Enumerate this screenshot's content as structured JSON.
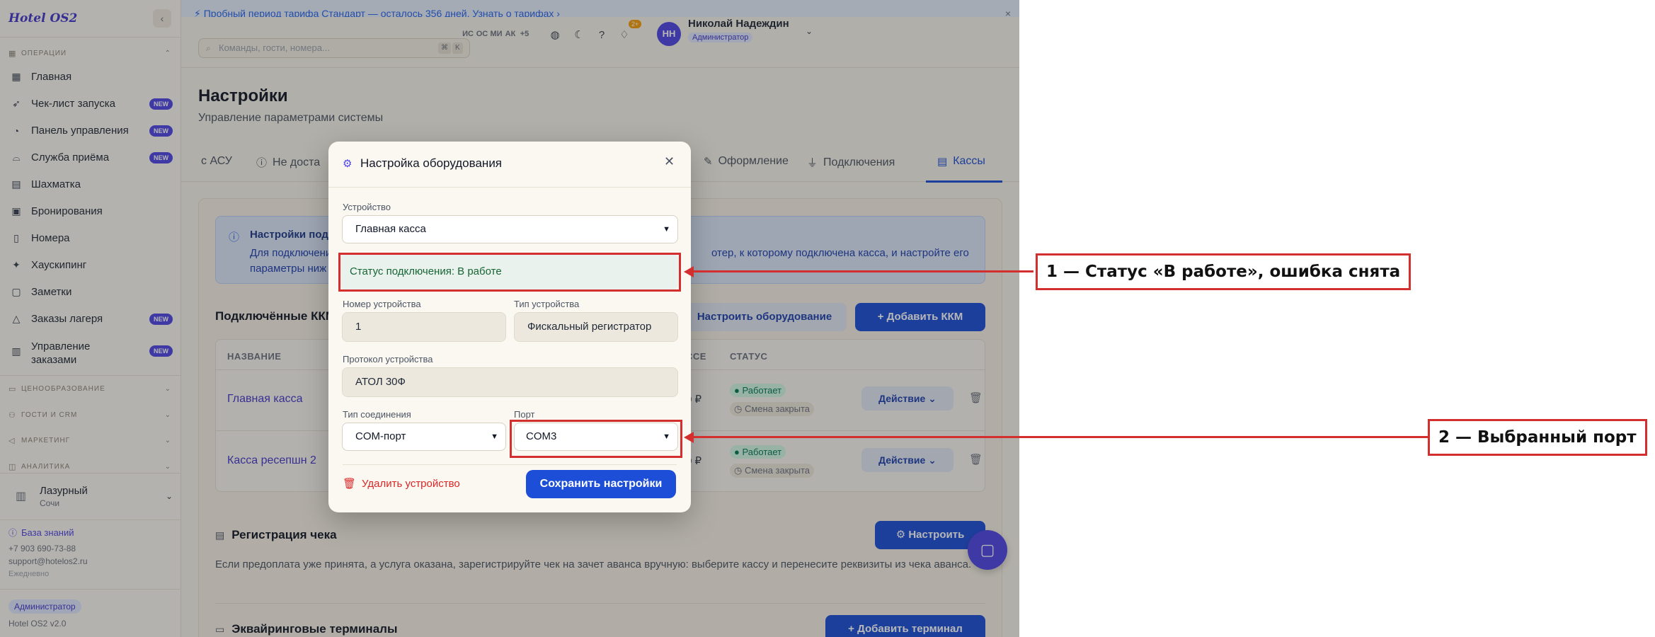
{
  "app": {
    "brand": "Hotel OS2",
    "collapse_icon": "‹"
  },
  "trial": {
    "text": "Пробный период тарифа Стандарт — осталось 356 дней. Узнать о тарифах ›",
    "close": "×"
  },
  "sidebar": {
    "section_operations": "ОПЕРАЦИИ",
    "items": [
      {
        "label": "Главная",
        "badge": ""
      },
      {
        "label": "Чек-лист запуска",
        "badge": "NEW"
      },
      {
        "label": "Панель управления",
        "badge": "NEW"
      },
      {
        "label": "Служба приёма",
        "badge": "NEW"
      },
      {
        "label": "Шахматка",
        "badge": ""
      },
      {
        "label": "Бронирования",
        "badge": ""
      },
      {
        "label": "Номера",
        "badge": ""
      },
      {
        "label": "Хаускипинг",
        "badge": ""
      },
      {
        "label": "Заметки",
        "badge": ""
      },
      {
        "label": "Заказы лагеря",
        "badge": "NEW"
      },
      {
        "label": "Управление заказами",
        "badge": "NEW"
      }
    ],
    "sections": [
      "ЦЕНООБРАЗОВАНИЕ",
      "ГОСТИ И CRM",
      "МАРКЕТИНГ",
      "АНАЛИТИКА"
    ],
    "hotel": {
      "name": "Лазурный",
      "city": "Сочи"
    },
    "knowledge_base": "База знаний",
    "phone": "+7 903 690-73-88",
    "email": "support@hotelos2.ru",
    "schedule": "Ежедневно",
    "role": "Администратор",
    "version": "Hotel OS2 v2.0"
  },
  "topbar": {
    "search_placeholder": "Команды, гости, номера...",
    "kbd1": "⌘",
    "kbd2": "K",
    "online_users": [
      "ИС",
      "ОС",
      "МИ",
      "АК",
      "+5"
    ],
    "notifications_count": "2+",
    "user_initials": "НН",
    "user_name": "Николай Надеждин",
    "user_role": "Администратор"
  },
  "page": {
    "title": "Настройки",
    "subtitle": "Управление параметрами системы",
    "tabs": [
      "с АСУ",
      "Не доста",
      "Оформление",
      "Подключения",
      "Кассы"
    ],
    "info_title": "Настройки под",
    "info_text_left": "Для подключени",
    "info_text_right": "отер, к которому подключена касса, и настройте его",
    "info_text_line2": "параметры ниж",
    "connected_title": "Подключённые ККМ",
    "configure_button": "Настроить оборудование",
    "add_kkm_button": "+ Добавить ККМ",
    "table": {
      "headers": [
        "НАЗВАНИЕ",
        "ССЕ",
        "СТАТУС"
      ],
      "rows": [
        {
          "name": "Главная касса",
          "value": "0 ₽",
          "status": "Работает",
          "shift": "Смена закрыта",
          "action": "Действие"
        },
        {
          "name": "Касса ресепшн 2",
          "value": "0 ₽",
          "status": "Работает",
          "shift": "Смена закрыта",
          "action": "Действие"
        }
      ]
    },
    "receipt_title": "Регистрация чека",
    "receipt_button": "Настроить",
    "receipt_text": "Если предоплата уже принята, а услуга оказана, зарегистрируйте чек на зачет аванса вручную: выберите кассу и перенесите реквизиты из чека аванса.",
    "acquiring_title": "Эквайринговые терминалы",
    "add_terminal_button": "+ Добавить терминал"
  },
  "modal": {
    "title": "Настройка оборудования",
    "device_label": "Устройство",
    "device_value": "Главная касса",
    "status_text": "Статус подключения: В работе",
    "device_number_label": "Номер устройства",
    "device_number_value": "1",
    "device_type_label": "Тип устройства",
    "device_type_value": "Фискальный регистратор",
    "protocol_label": "Протокол устройства",
    "protocol_value": "АТОЛ 30Ф",
    "connection_type_label": "Тип соединения",
    "connection_type_value": "COM-порт",
    "port_label": "Порт",
    "port_value": "COM3",
    "delete_button": "Удалить устройство",
    "save_button": "Сохранить настройки"
  },
  "annotations": {
    "callout1": "1 — Статус «В работе», ошибка снята",
    "callout2": "2 — Выбранный порт",
    "color": "#d32f2f"
  }
}
